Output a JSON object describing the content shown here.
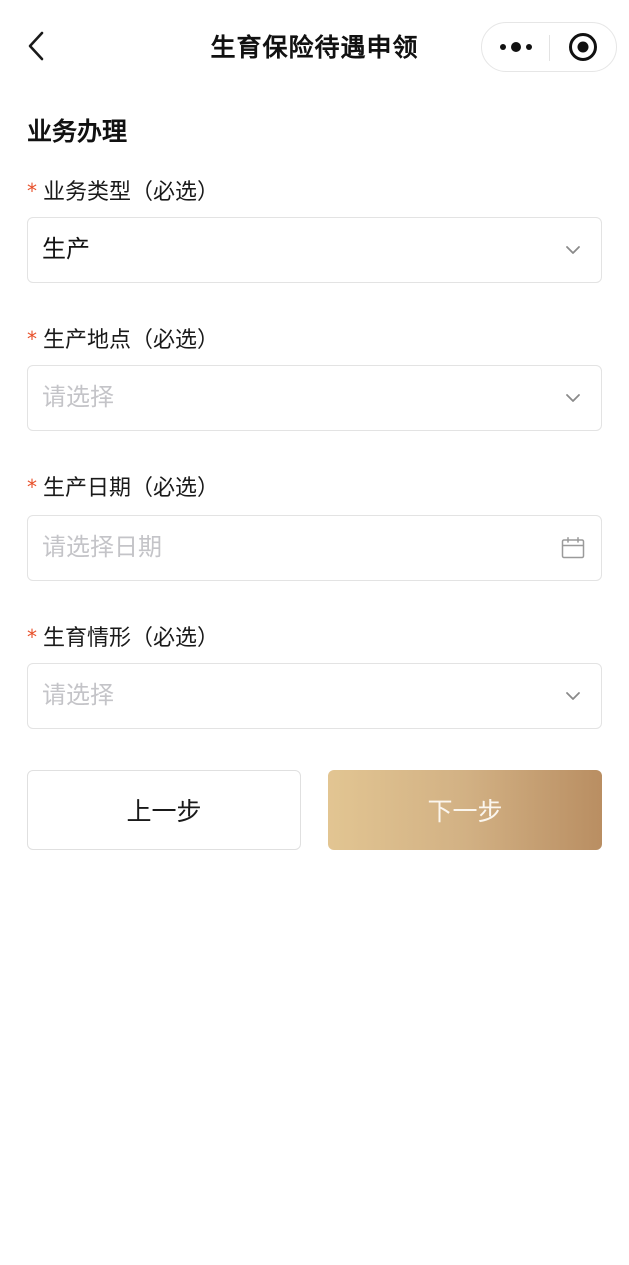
{
  "navbar": {
    "title": "生育保险待遇申领",
    "back_icon": "chevron-left-icon",
    "more_icon": "more-dots-icon",
    "close_icon": "target-close-icon"
  },
  "section": {
    "title": "业务办理"
  },
  "fields": [
    {
      "required_mark": "*",
      "label": "业务类型（必选）",
      "value": "生产",
      "placeholder": "",
      "icon": "chevron-down-icon"
    },
    {
      "required_mark": "*",
      "label": "生产地点（必选）",
      "value": "",
      "placeholder": "请选择",
      "icon": "chevron-down-icon"
    },
    {
      "required_mark": "*",
      "label": "生产日期（必选）",
      "value": "",
      "placeholder": "请选择日期",
      "icon": "calendar-icon"
    },
    {
      "required_mark": "*",
      "label": "生育情形（必选）",
      "value": "",
      "placeholder": "请选择",
      "icon": "chevron-down-icon"
    }
  ],
  "buttons": {
    "prev_label": "上一步",
    "next_label": "下一步"
  },
  "colors": {
    "required": "#e8502a",
    "next_gradient_start": "#e2c592",
    "next_gradient_end": "#b98e62",
    "placeholder": "#c4c4c8"
  }
}
